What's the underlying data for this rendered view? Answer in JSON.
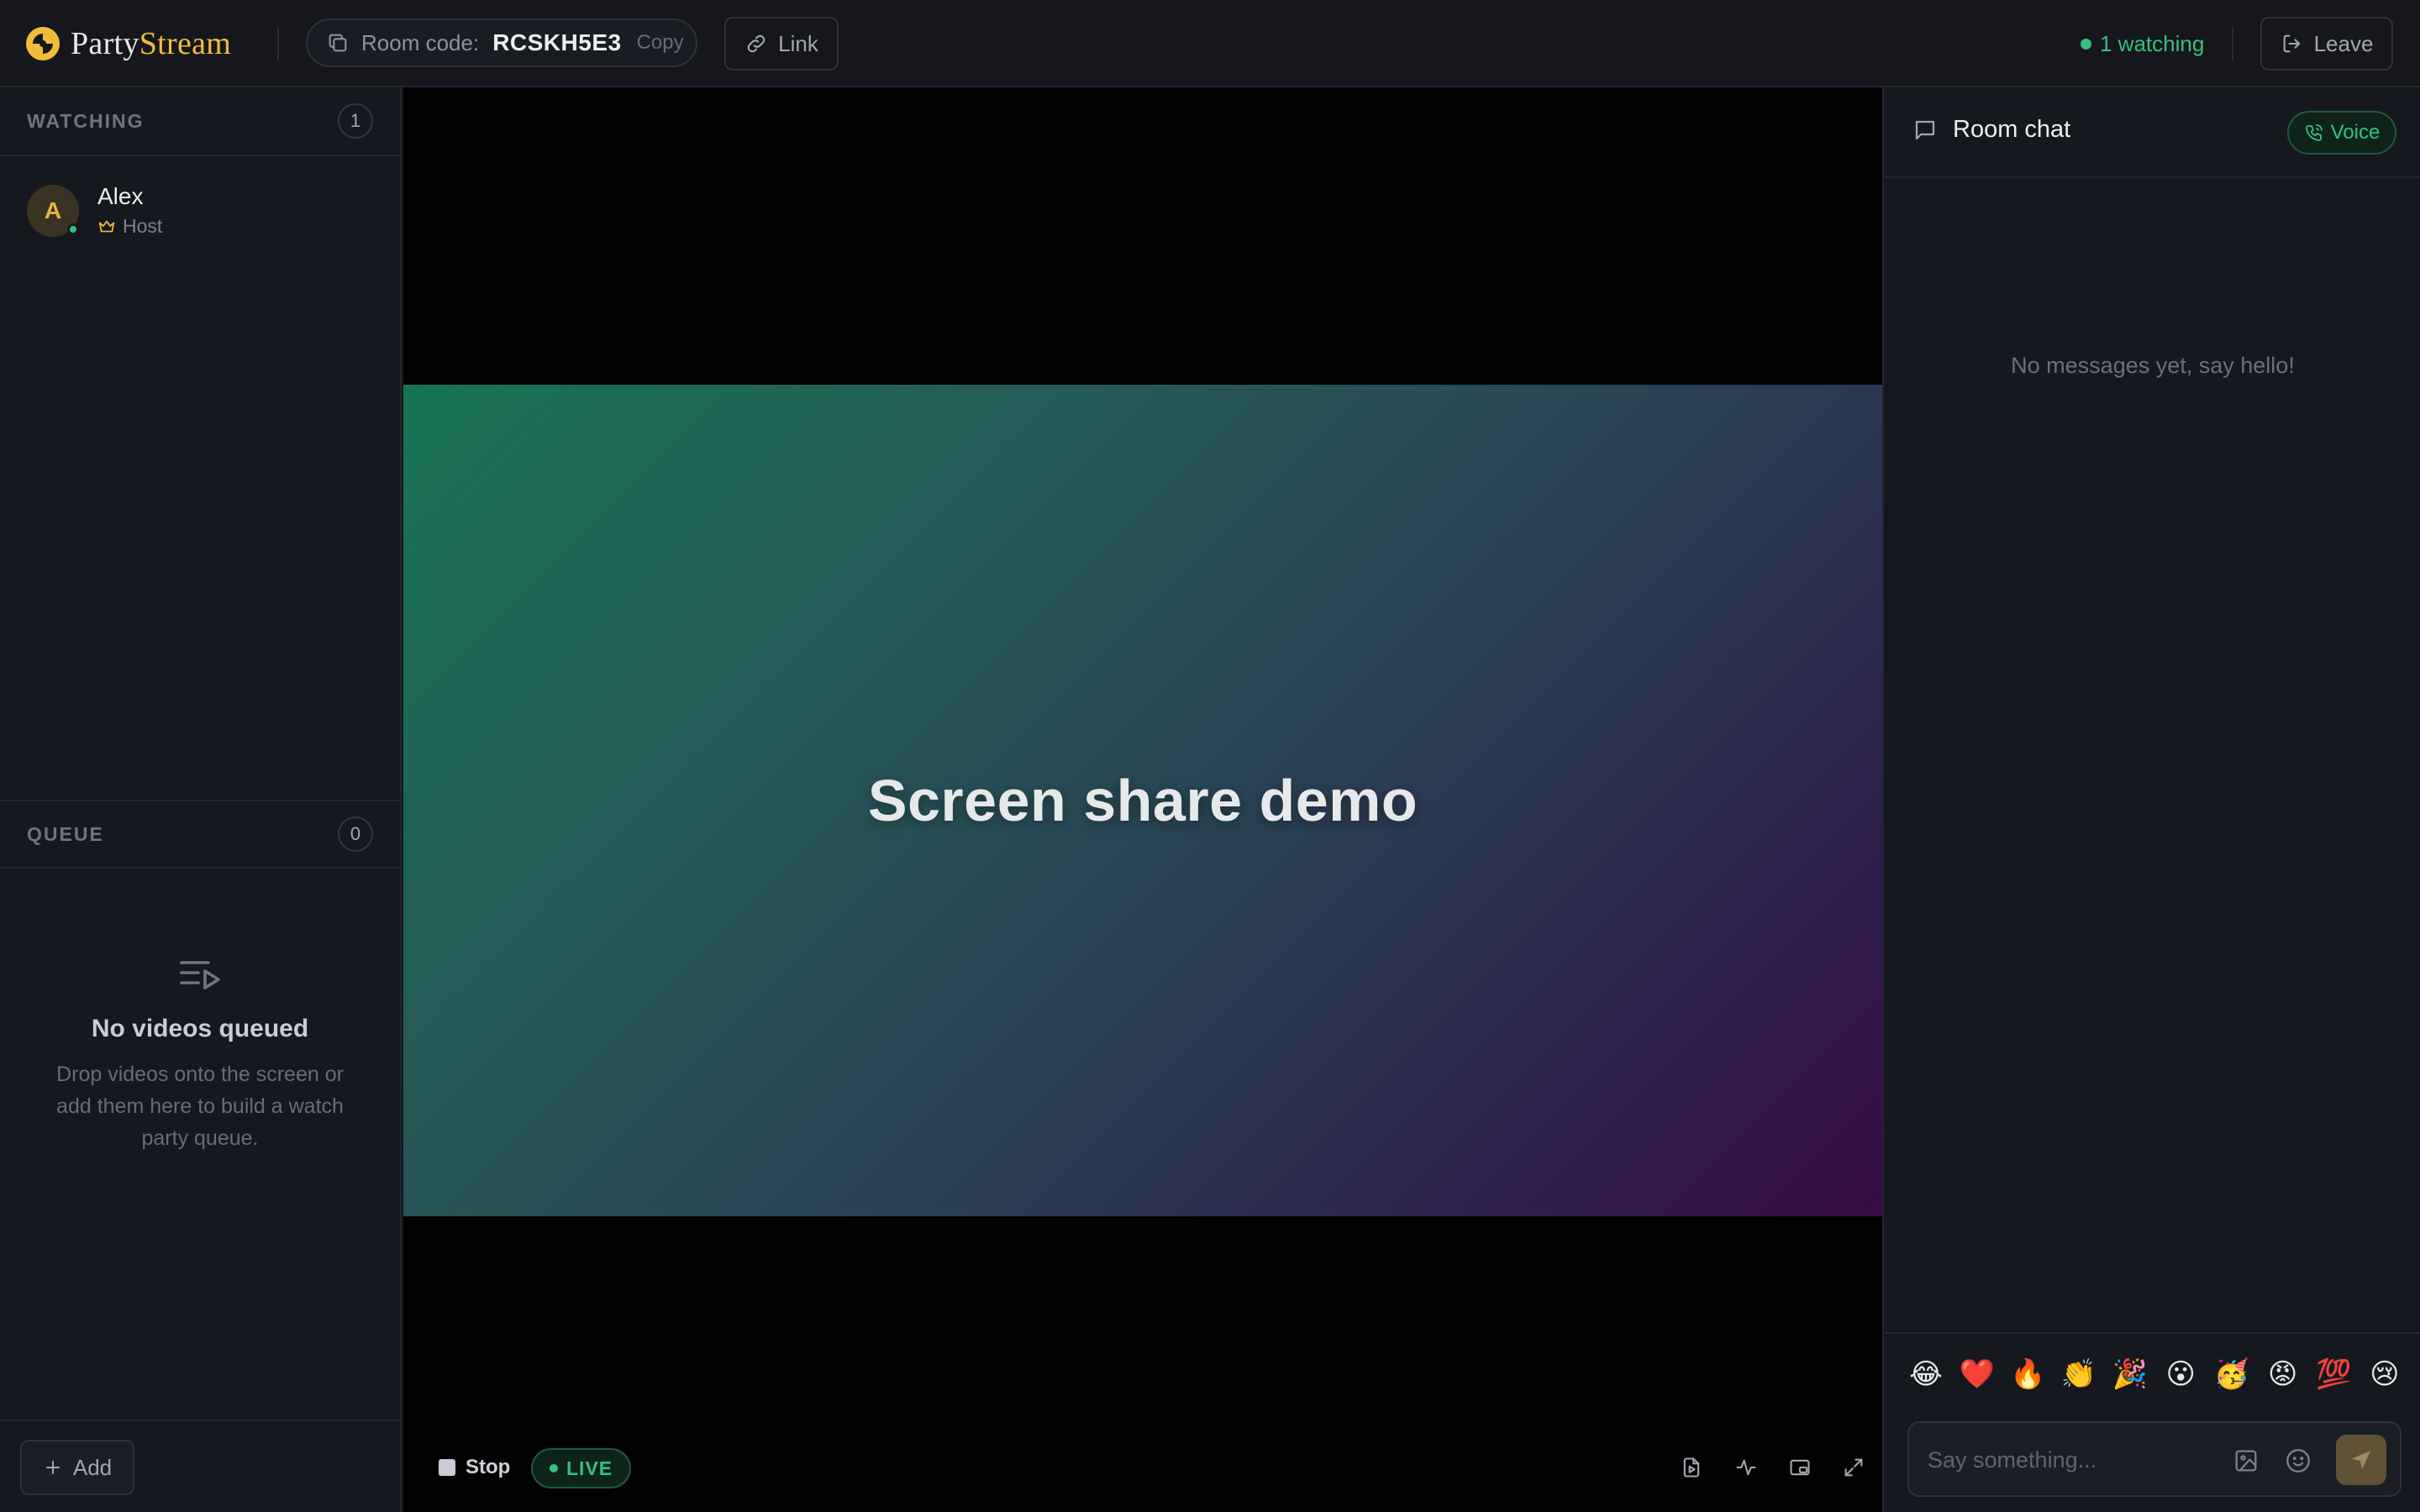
{
  "brand": {
    "name_part1": "Party",
    "name_part2": "Stream"
  },
  "header": {
    "room_label": "Room code:",
    "room_code": "RCSKH5E3",
    "copy_label": "Copy",
    "link_label": "Link",
    "watching_label": "1 watching",
    "leave_label": "Leave"
  },
  "sidebar": {
    "watching": {
      "title": "WATCHING",
      "count": "1",
      "members": [
        {
          "initial": "A",
          "name": "Alex",
          "role": "Host"
        }
      ]
    },
    "queue": {
      "title": "QUEUE",
      "count": "0",
      "empty_title": "No videos queued",
      "empty_desc": "Drop videos onto the screen or add them here to build a watch party queue."
    },
    "add_label": "Add"
  },
  "stage": {
    "share_title": "Screen share demo",
    "stop_label": "Stop",
    "live_label": "LIVE"
  },
  "chat": {
    "title": "Room chat",
    "voice_label": "Voice",
    "empty_text": "No messages yet, say hello!",
    "input_placeholder": "Say something...",
    "emojis": [
      "😂",
      "❤️",
      "🔥",
      "👏",
      "🎉",
      "😮",
      "🥳",
      "😡",
      "💯",
      "😢"
    ]
  },
  "colors": {
    "accent_gold": "#f0bd3a",
    "live_green": "#35c07f",
    "background": "#14161c"
  }
}
